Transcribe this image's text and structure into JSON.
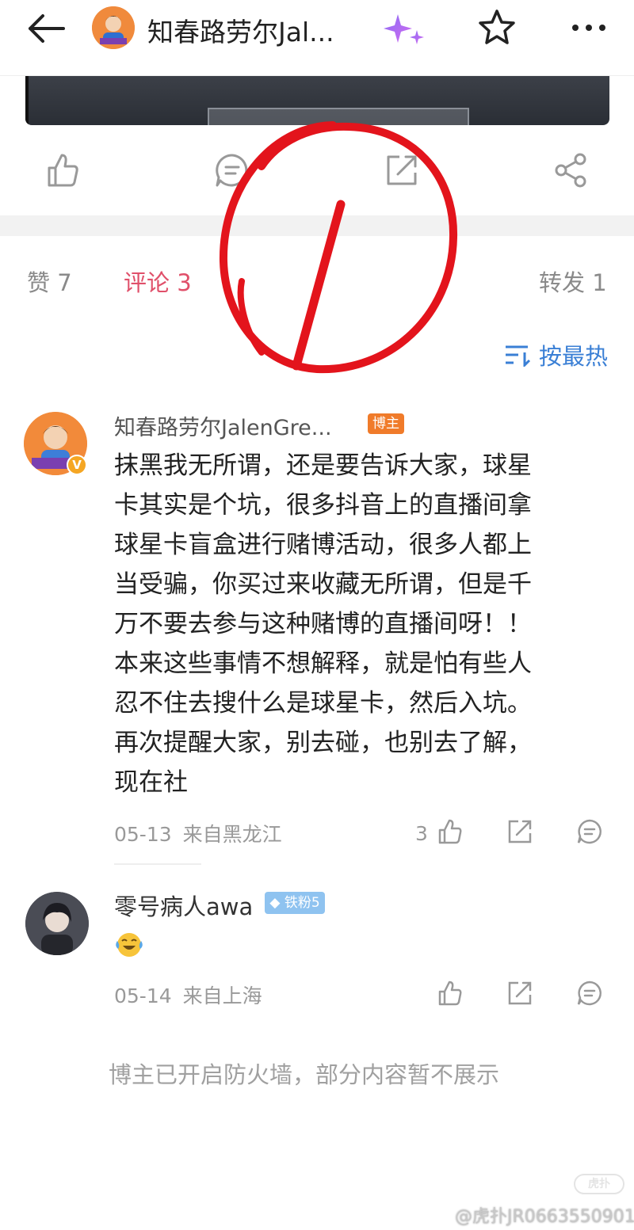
{
  "header": {
    "title": "知春路劳尔Jal...",
    "icons": [
      "back-arrow-icon",
      "avatar",
      "sparkle-icon",
      "star-icon",
      "more-icon"
    ]
  },
  "actions": {
    "icons": [
      "thumbs-up-icon",
      "comment-icon",
      "repost-icon",
      "share-icon"
    ]
  },
  "tabs": {
    "likes": "赞 7",
    "comments": "评论 3",
    "reposts": "转发 1"
  },
  "sort": {
    "label": "按最热"
  },
  "comments": [
    {
      "author": "知春路劳尔JalenGre...",
      "tag": "博主",
      "avatar_text": "知春路劳尔",
      "verified": "V",
      "lines": [
        "抹黑我无所谓，还是要告诉大家，球星",
        "卡其实是个坑，很多抖音上的直播间拿",
        "球星卡盲盒进行赌博活动，很多人都上",
        "当受骗，你买过来收藏无所谓，但是千",
        "万不要去参与这种赌博的直播间呀！！",
        "本来这些事情不想解释，就是怕有些人",
        "忍不住去搜什么是球星卡，然后入坑。",
        "再次提醒大家，别去碰，也别去了解，",
        "现在社"
      ],
      "date": "05-13",
      "location": "来自黑龙江",
      "likes": "3"
    },
    {
      "author": "零号病人awa",
      "tag": "铁粉5",
      "date": "05-14",
      "location": "来自上海"
    }
  ],
  "footer": {
    "firewall_note": "博主已开启防火墙，部分内容暂不展示",
    "watermark": "@虎扑JR0663550901",
    "watermark_logo": "虎扑"
  },
  "colors": {
    "accent_red": "#e0506a",
    "sort_blue": "#3a7fd5",
    "blogger_tag": "#f07b2a",
    "fan_tag": "#8fc3f0",
    "annotation_red": "#e3141c"
  }
}
